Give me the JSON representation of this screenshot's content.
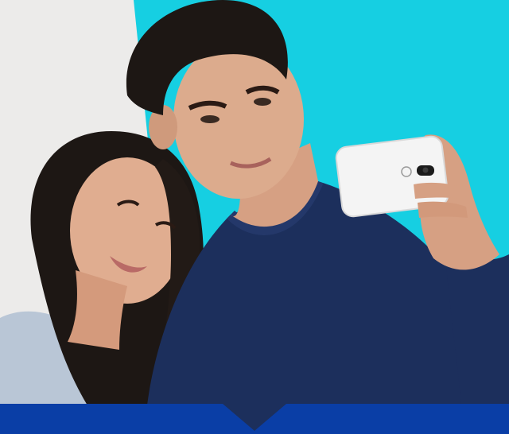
{
  "scene": {
    "description_icon": "couple-selfie-photo",
    "phone_logo": "motorola-logo-icon"
  },
  "colors": {
    "background_left": "#ecebea",
    "background_right": "#16cfe2",
    "sweater": "#1c2f5c",
    "woman_top": "#b9c6d6",
    "phone_body": "#f4f4f4",
    "hair": "#1d1714",
    "skin": "#d9a88b",
    "bottom_bar": "#0a3ea6",
    "notch": "#ffffff"
  }
}
